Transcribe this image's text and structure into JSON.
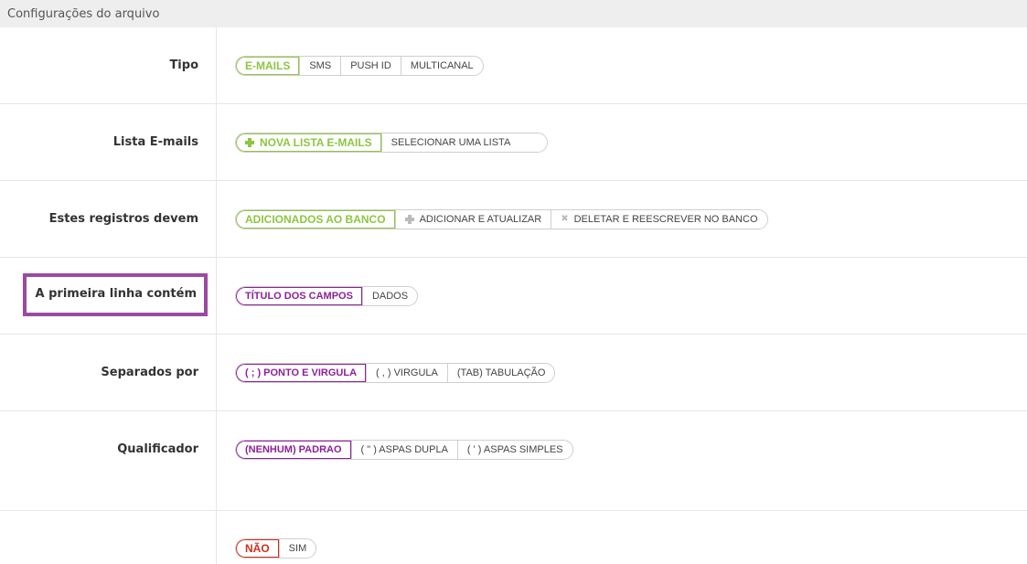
{
  "header": {
    "title": "Configurações do arquivo"
  },
  "rows": [
    {
      "label": "Tipo",
      "options": [
        "E-MAILS",
        "SMS",
        "PUSH ID",
        "MULTICANAL"
      ]
    },
    {
      "label": "Lista E-mails",
      "options": [
        "NOVA LISTA E-MAILS",
        "SELECIONAR UMA LISTA"
      ]
    },
    {
      "label": "Estes registros devem",
      "options": [
        "ADICIONADOS AO BANCO",
        "ADICIONAR E ATUALIZAR",
        "DELETAR E REESCREVER NO BANCO"
      ]
    },
    {
      "label": "A primeira linha contém",
      "options": [
        "TÍTULO DOS CAMPOS",
        "DADOS"
      ]
    },
    {
      "label": "Separados por",
      "options": [
        "( ; ) PONTO E VIRGULA",
        "( , ) VIRGULA",
        "(TAB) TABULAÇÃO"
      ]
    },
    {
      "label": "Qualificador",
      "options": [
        "(NENHUM) PADRAO",
        "( \" ) ASPAS DUPLA",
        "( ' ) ASPAS SIMPLES"
      ]
    },
    {
      "label": "",
      "options": [
        "NÃO",
        "SIM"
      ]
    }
  ],
  "colors": {
    "green": "#8dc63f",
    "purple": "#8e1f9a",
    "red": "#d52b1e",
    "highlight": "#9b4aa1"
  }
}
